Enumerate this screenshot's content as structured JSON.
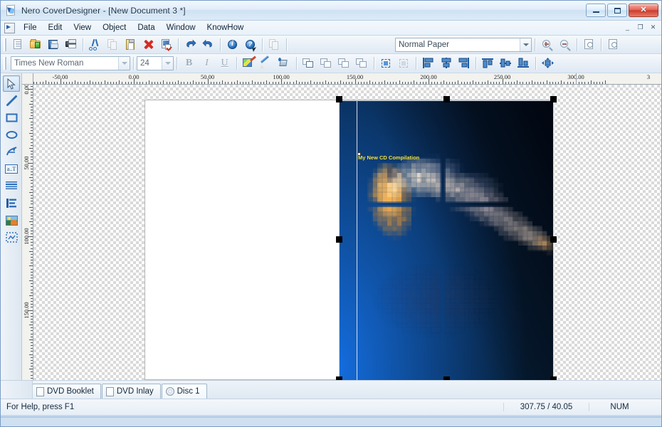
{
  "window": {
    "title": "Nero CoverDesigner - [New Document 3 *]",
    "app_icon": "nero-coverdesigner-icon",
    "controls": {
      "minimize": "–",
      "maximize": "□",
      "close": "✕"
    },
    "mdi_controls": {
      "minimize": "_",
      "restore": "❐",
      "close": "✕"
    }
  },
  "menubar": {
    "items": [
      {
        "label": "File"
      },
      {
        "label": "Edit"
      },
      {
        "label": "View"
      },
      {
        "label": "Object"
      },
      {
        "label": "Data"
      },
      {
        "label": "Window"
      },
      {
        "label": "KnowHow"
      }
    ]
  },
  "standard_toolbar": {
    "buttons": [
      {
        "name": "new-document",
        "icon": "new-document-icon",
        "tooltip": "New"
      },
      {
        "name": "open-document",
        "icon": "open-folder-icon",
        "tooltip": "Open"
      },
      {
        "name": "save-document",
        "icon": "floppy-save-icon",
        "tooltip": "Save"
      },
      {
        "name": "print",
        "icon": "printer-icon",
        "tooltip": "Print"
      },
      {
        "name": "cut",
        "icon": "scissors-icon",
        "tooltip": "Cut"
      },
      {
        "name": "copy",
        "icon": "copy-pages-icon",
        "tooltip": "Copy"
      },
      {
        "name": "paste",
        "icon": "clipboard-icon",
        "tooltip": "Paste"
      },
      {
        "name": "delete",
        "icon": "red-x-icon",
        "tooltip": "Delete"
      },
      {
        "name": "document-properties",
        "icon": "document-check-icon",
        "tooltip": "Document Properties"
      },
      {
        "name": "undo",
        "icon": "undo-arrow-icon",
        "tooltip": "Undo"
      },
      {
        "name": "redo",
        "icon": "redo-arrow-icon",
        "tooltip": "Redo"
      },
      {
        "name": "info",
        "icon": "info-circle-icon",
        "tooltip": "Info"
      },
      {
        "name": "context-help",
        "icon": "help-question-icon",
        "tooltip": "Help"
      },
      {
        "name": "page-view",
        "icon": "page-stack-icon",
        "tooltip": "Page View"
      }
    ],
    "paper_select": {
      "value": "Normal Paper",
      "placeholder": "Normal Paper"
    },
    "zoom_in": "zoom-in-icon",
    "zoom_out": "zoom-out-icon",
    "preview": "print-preview-icon",
    "preview2": "page-preview-icon"
  },
  "format_toolbar": {
    "font_select": {
      "value": "Times New Roman"
    },
    "size_select": {
      "value": "24"
    },
    "bold": "B",
    "italic": "I",
    "underline": "U",
    "buttons": [
      {
        "name": "fill-properties",
        "icon": "palette-pen-icon"
      },
      {
        "name": "pen-properties",
        "icon": "pencil-icon"
      },
      {
        "name": "fill-color",
        "icon": "paint-bucket-icon"
      },
      {
        "name": "bring-to-front",
        "icon": "bring-to-front-icon"
      },
      {
        "name": "send-to-back",
        "icon": "send-to-back-icon"
      },
      {
        "name": "bring-forward",
        "icon": "bring-forward-icon"
      },
      {
        "name": "send-backward",
        "icon": "send-backward-icon"
      },
      {
        "name": "select-all-objects",
        "icon": "select-all-icon"
      },
      {
        "name": "deselect-objects",
        "icon": "deselect-icon"
      },
      {
        "name": "align-left",
        "icon": "align-left-icon"
      },
      {
        "name": "align-center-horizontal",
        "icon": "align-center-h-icon"
      },
      {
        "name": "align-right",
        "icon": "align-right-icon"
      },
      {
        "name": "align-top",
        "icon": "align-top-icon"
      },
      {
        "name": "align-middle-vertical",
        "icon": "align-middle-v-icon"
      },
      {
        "name": "align-bottom",
        "icon": "align-bottom-icon"
      },
      {
        "name": "center-on-page",
        "icon": "center-on-page-icon"
      }
    ]
  },
  "tool_palette": {
    "tools": [
      {
        "name": "select-tool",
        "icon": "arrow-pointer-icon",
        "active": true
      },
      {
        "name": "line-tool",
        "icon": "line-icon",
        "active": false
      },
      {
        "name": "rectangle-tool",
        "icon": "rectangle-icon",
        "active": false
      },
      {
        "name": "ellipse-tool",
        "icon": "ellipse-icon",
        "active": false
      },
      {
        "name": "curve-tool",
        "icon": "curve-pen-icon",
        "active": false
      },
      {
        "name": "artistic-text-tool",
        "icon": "text-field-icon",
        "active": false
      },
      {
        "name": "text-box-tool",
        "icon": "paragraph-lines-icon",
        "active": false
      },
      {
        "name": "track-list-tool",
        "icon": "track-list-icon",
        "active": false
      },
      {
        "name": "image-tool",
        "icon": "picture-icon",
        "active": false
      },
      {
        "name": "placeholder-tool",
        "icon": "dotted-selection-icon",
        "active": false
      }
    ]
  },
  "rulers": {
    "horizontal": {
      "labels": [
        "-50.00",
        "0.00",
        "50.00",
        "100.00",
        "150.00",
        "200.00",
        "250.00",
        "300.00",
        "3"
      ],
      "unit": "mm"
    },
    "vertical": {
      "labels": [
        "0.00",
        "50.00",
        "100.00",
        "150.00"
      ],
      "unit": "mm"
    }
  },
  "canvas": {
    "page_label": "dvd-booklet-page",
    "selected_object": "image-object",
    "text_object": {
      "content": "My New CD Compilation",
      "color": "#f2e84a"
    },
    "image": {
      "description": "pixelated space nebula on blue gradient",
      "background_gradient": [
        "#0a5fd4",
        "#062a6b",
        "#020a22"
      ],
      "accent_color": "#e8962c"
    }
  },
  "tabs": [
    {
      "name": "tab-dvd-booklet",
      "label": "DVD Booklet",
      "icon": "page-icon",
      "active": false
    },
    {
      "name": "tab-dvd-inlay",
      "label": "DVD Inlay",
      "icon": "page-icon",
      "active": false
    },
    {
      "name": "tab-disc-1",
      "label": "Disc 1",
      "icon": "disc-icon",
      "active": true
    }
  ],
  "statusbar": {
    "help_text": "For Help, press F1",
    "coordinates": "307.75 / 40.05",
    "num_lock": "NUM"
  },
  "colors": {
    "accent": "#1f5da8",
    "titlebar": "#dcebf9",
    "close_button": "#cc3c2c",
    "text_yellow": "#f2e84a"
  }
}
